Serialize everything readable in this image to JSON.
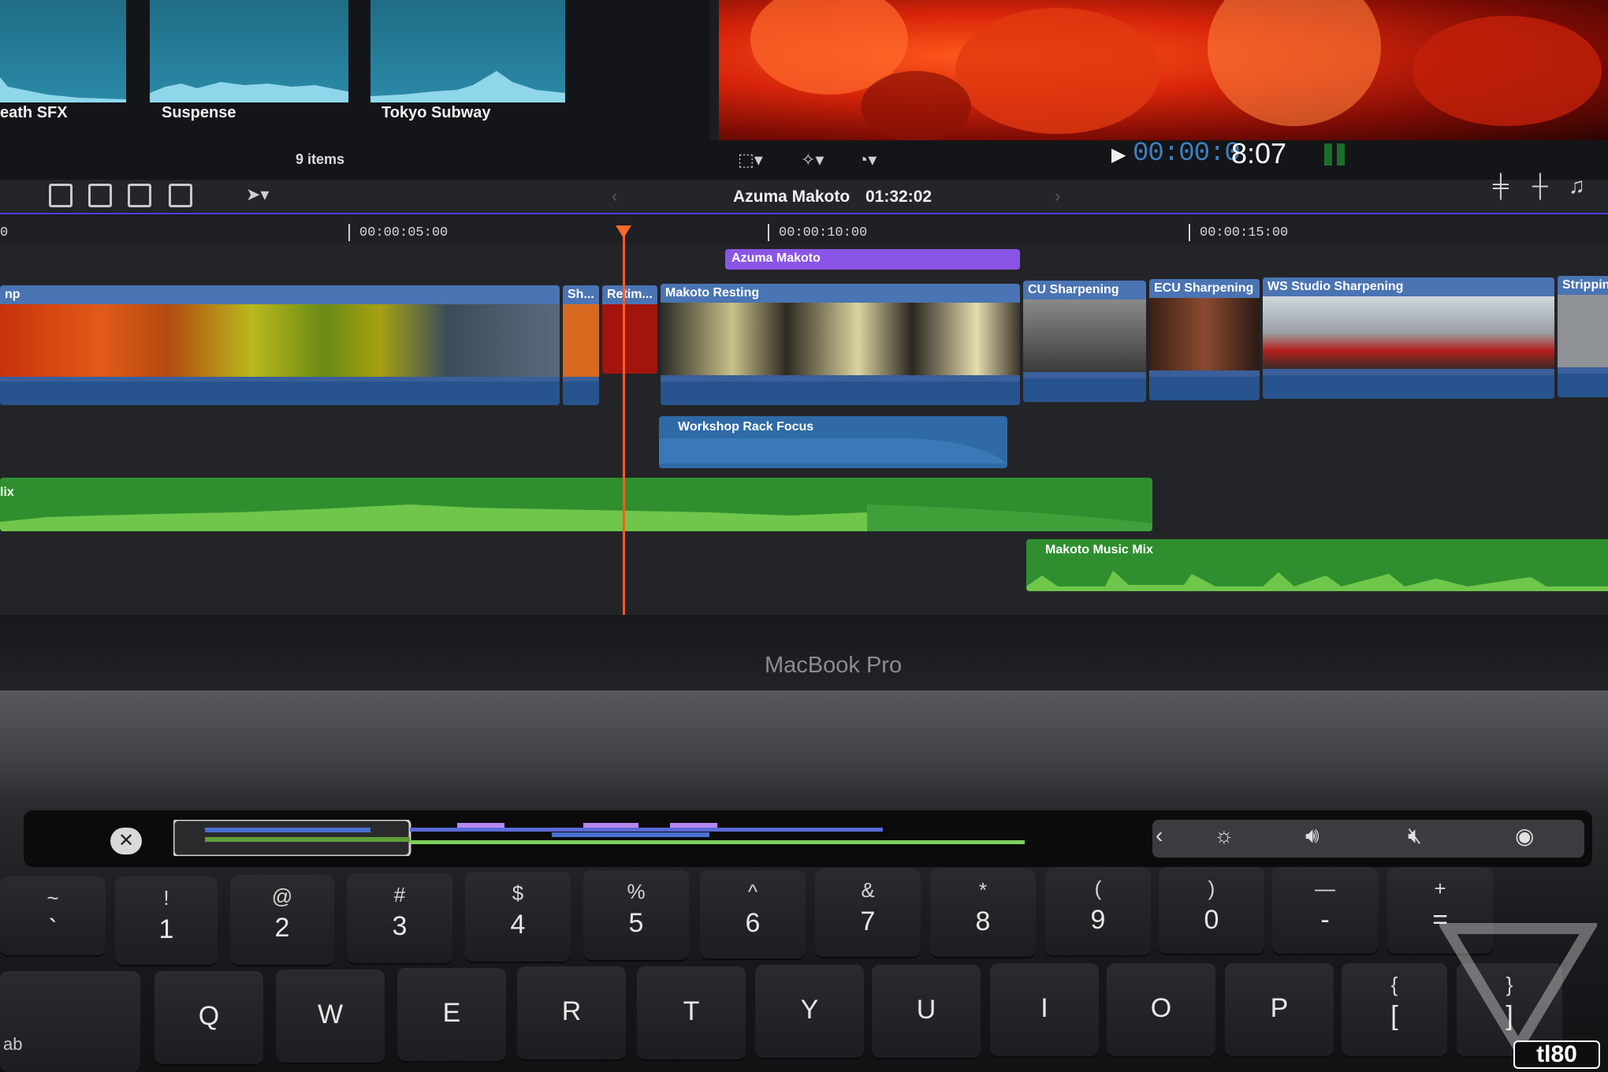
{
  "browser": {
    "thumbs": [
      {
        "label": "eath SFX"
      },
      {
        "label": "Suspense"
      },
      {
        "label": "Tokyo Subway"
      }
    ],
    "items_count": "9 items"
  },
  "viewer": {
    "timecode_dim": "00:00:0",
    "timecode_bright": "8:07",
    "play_icon": "play-icon",
    "transform_icon": "transform-icon",
    "magic_icon": "enhance-icon",
    "speed_icon": "retime-speed-icon"
  },
  "timeline": {
    "project_name": "Azuma Makoto",
    "duration": "01:32:02",
    "ruler": [
      "0",
      "00:00:05:00",
      "00:00:10:00",
      "00:00:15:00"
    ],
    "title_clip": "Azuma Makoto",
    "primary_clips": [
      {
        "name": "np"
      },
      {
        "name": "Sh..."
      },
      {
        "name": "Retim..."
      },
      {
        "name": "Makoto Resting"
      },
      {
        "name": "CU Sharpening"
      },
      {
        "name": "ECU Sharpening"
      },
      {
        "name": "WS Studio Sharpening"
      },
      {
        "name": "Strippin"
      }
    ],
    "connected_clip": "Workshop Rack Focus",
    "music_clip_1": "lix",
    "music_clip_2": "Makoto Music Mix"
  },
  "hardware": {
    "brand": "MacBook Pro"
  },
  "touchbar": {
    "close_icon": "close-icon",
    "controls": [
      "chevron-left-icon",
      "brightness-icon",
      "volume-icon",
      "mute-icon",
      "siri-icon"
    ]
  },
  "keyboard": {
    "number_row": [
      {
        "top": "~",
        "bot": "`"
      },
      {
        "top": "!",
        "bot": "1"
      },
      {
        "top": "@",
        "bot": "2"
      },
      {
        "top": "#",
        "bot": "3"
      },
      {
        "top": "$",
        "bot": "4"
      },
      {
        "top": "%",
        "bot": "5"
      },
      {
        "top": "^",
        "bot": "6"
      },
      {
        "top": "&",
        "bot": "7"
      },
      {
        "top": "*",
        "bot": "8"
      },
      {
        "top": "(",
        "bot": "9"
      },
      {
        "top": ")",
        "bot": "0"
      },
      {
        "top": "—",
        "bot": "-"
      },
      {
        "top": "+",
        "bot": "="
      }
    ],
    "letter_row": [
      "Q",
      "W",
      "E",
      "R",
      "T",
      "Y",
      "U",
      "I",
      "O",
      "P"
    ],
    "bracket_key": {
      "top": "{",
      "bot": "["
    },
    "brace_key": {
      "top": "}",
      "bot": "]"
    },
    "tab_label": "ab"
  },
  "watermark": "tl80",
  "colors": {
    "accent": "#4b3fd6",
    "title_clip": "#8a55e6",
    "video_clip": "#3a5f9a",
    "audio_clip": "#2f8f2f",
    "playhead": "#ff5a1f"
  }
}
